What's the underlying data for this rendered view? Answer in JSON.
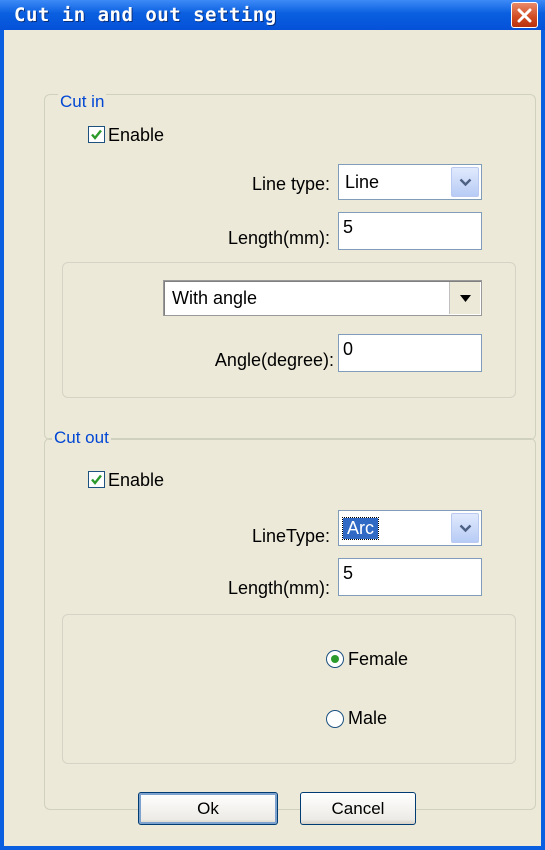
{
  "window": {
    "title": "Cut in and out setting"
  },
  "cut_in": {
    "legend": "Cut in",
    "enable_label": "Enable",
    "enable_checked": true,
    "line_type_label": "Line type:",
    "line_type_value": "Line",
    "length_label": "Length(mm):",
    "length_value": "5",
    "mode_value": "With angle",
    "angle_label": "Angle(degree):",
    "angle_value": "0"
  },
  "cut_out": {
    "legend": "Cut out",
    "enable_label": "Enable",
    "enable_checked": true,
    "line_type_label": "LineType:",
    "line_type_value": "Arc",
    "length_label": "Length(mm):",
    "length_value": "5",
    "female_label": "Female",
    "male_label": "Male",
    "selected": "Female"
  },
  "buttons": {
    "ok": "Ok",
    "cancel": "Cancel"
  },
  "icons": {
    "close": "close-icon",
    "check": "checkmark-icon",
    "dropdown": "chevron-down-icon",
    "dropdown_plain": "triangle-down-icon",
    "radio_selected": "radio-dot-icon"
  },
  "colors": {
    "title_bar": "#0a5fe0",
    "legend_text": "#0046d5",
    "dialog_bg": "#ece9d8",
    "selection": "#316ac5",
    "check": "#2c9b2c"
  }
}
